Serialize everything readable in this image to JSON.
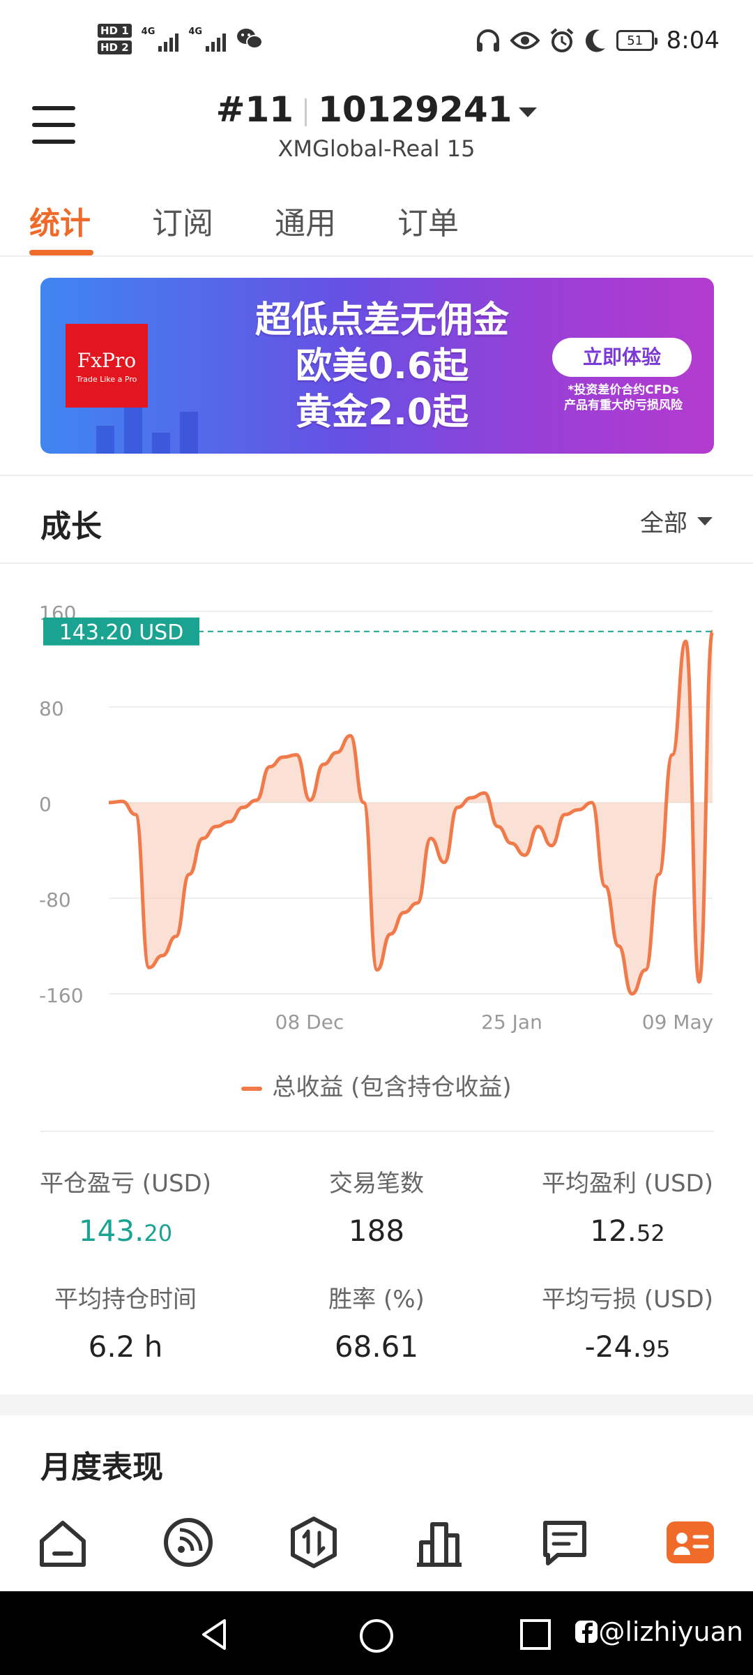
{
  "status_bar": {
    "hd1": "HD 1",
    "hd2": "HD 2",
    "net1": "4G",
    "net2": "4G",
    "battery": "51",
    "time": "8:04"
  },
  "header": {
    "account_number": "#11",
    "account_id": "10129241",
    "server": "XMGlobal-Real 15"
  },
  "tabs": [
    {
      "label": "统计",
      "active": true
    },
    {
      "label": "订阅",
      "active": false
    },
    {
      "label": "通用",
      "active": false
    },
    {
      "label": "订单",
      "active": false
    }
  ],
  "banner": {
    "logo_text": "FxPro",
    "logo_tagline": "Trade Like a Pro",
    "line1": "超低点差无佣金",
    "line2": "欧美0.6起",
    "line3": "黄金2.0起",
    "button": "立即体验",
    "risk_line1": "*投资差价合约CFDs",
    "risk_line2": "产品有重大的亏损风险"
  },
  "growth": {
    "title": "成长",
    "range": "全部",
    "legend": "总收益 (包含持仓收益)",
    "current_label": "143.20 USD"
  },
  "chart_data": {
    "type": "area",
    "ylim": [
      -160,
      160
    ],
    "yticks": [
      "160",
      "80",
      "0",
      "-80",
      "-160"
    ],
    "xtick_labels": [
      "08 Dec",
      "25 Jan",
      "09 May"
    ],
    "current_value": 143.2,
    "series": [
      {
        "values": [
          0,
          1,
          -10,
          -138,
          -128,
          -112,
          -60,
          -30,
          -20,
          -16,
          -4,
          2,
          30,
          38,
          40,
          2,
          32,
          42,
          56,
          0,
          -140,
          -110,
          -92,
          -84,
          -30,
          -50,
          -4,
          4,
          8,
          -20,
          -34,
          -44,
          -20,
          -36,
          -10,
          -6,
          0,
          -70,
          -120,
          -160,
          -140,
          -60,
          40,
          135,
          -150,
          143.2
        ]
      }
    ]
  },
  "stats": [
    {
      "label": "平仓盈亏 (USD)",
      "int": "143.",
      "dec": "20",
      "positive": true
    },
    {
      "label": "交易笔数",
      "int": "188",
      "dec": "",
      "positive": false
    },
    {
      "label": "平均盈利 (USD)",
      "int": "12.",
      "dec": "52",
      "positive": false
    },
    {
      "label": "平均持仓时间",
      "int": "6.2 h",
      "dec": "",
      "positive": false
    },
    {
      "label": "胜率 (%)",
      "int": "68.61",
      "dec": "",
      "positive": false
    },
    {
      "label": "平均亏损 (USD)",
      "int": "-24.",
      "dec": "95",
      "positive": false
    }
  ],
  "monthly": {
    "title": "月度表现"
  },
  "watermark": "@lizhiyuan",
  "colors": {
    "accent": "#f06a2a",
    "line": "#f07a4a",
    "positive": "#1aa391"
  }
}
